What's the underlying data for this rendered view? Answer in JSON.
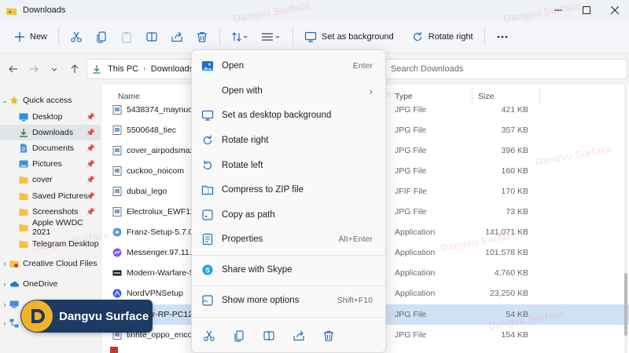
{
  "window": {
    "title": "Downloads"
  },
  "toolbar": {
    "new_label": "New",
    "set_background_label": "Set as background",
    "rotate_right_label": "Rotate right"
  },
  "address": {
    "crumbs": [
      "This PC",
      "Downloads"
    ],
    "search_placeholder": "Search Downloads"
  },
  "sidebar": {
    "items": [
      {
        "label": "Quick access",
        "pinned": false
      },
      {
        "label": "Desktop",
        "pinned": true
      },
      {
        "label": "Downloads",
        "pinned": true
      },
      {
        "label": "Documents",
        "pinned": true
      },
      {
        "label": "Pictures",
        "pinned": true
      },
      {
        "label": "cover",
        "pinned": true
      },
      {
        "label": "Saved Pictures",
        "pinned": true
      },
      {
        "label": "Screenshots",
        "pinned": true
      },
      {
        "label": "Apple WWDC 2021",
        "pinned": false
      },
      {
        "label": "Telegram Desktop",
        "pinned": false
      },
      {
        "label": "Creative Cloud Files",
        "pinned": false
      },
      {
        "label": "OneDrive",
        "pinned": false
      }
    ]
  },
  "columns": {
    "name": "Name",
    "type": "Type",
    "size": "Size"
  },
  "files": [
    {
      "name": "5438374_maynuongbanh",
      "type": "JPG File",
      "size": "421 KB"
    },
    {
      "name": "5500648_tiec",
      "type": "JPG File",
      "size": "357 KB"
    },
    {
      "name": "cover_airpodsmax_fix",
      "type": "JPG File",
      "size": "396 KB"
    },
    {
      "name": "cuckoo_noicom",
      "type": "JPG File",
      "size": "160 KB"
    },
    {
      "name": "dubai_lego",
      "type": "JFIF File",
      "size": "170 KB"
    },
    {
      "name": "Electrolux_EWF1141S",
      "type": "JPG File",
      "size": "73 KB"
    },
    {
      "name": "Franz-Setup-5.7.0",
      "type": "Application",
      "size": "141,071 KB"
    },
    {
      "name": "Messenger.97.11.116",
      "type": "Application",
      "size": "101,578 KB"
    },
    {
      "name": "Modern-Warfare-Setup",
      "type": "Application",
      "size": "4,760 KB"
    },
    {
      "name": "NordVPNSetup",
      "type": "Application",
      "size": "23,250 KB"
    },
    {
      "name": "Pioneer-RP-PC128",
      "type": "JPG File",
      "size": "54 KB"
    },
    {
      "name": "tinhte_oppo_encox",
      "type": "JPG File",
      "size": "154 KB"
    }
  ],
  "context_menu": {
    "items": [
      {
        "label": "Open",
        "shortcut": "Enter",
        "icon": "photo-icon"
      },
      {
        "label": "Open with",
        "shortcut": "",
        "icon": "blank"
      },
      {
        "label": "Set as desktop background",
        "shortcut": "",
        "icon": "desktop-icon"
      },
      {
        "label": "Rotate right",
        "shortcut": "",
        "icon": "rotate-right-icon"
      },
      {
        "label": "Rotate left",
        "shortcut": "",
        "icon": "rotate-left-icon"
      },
      {
        "label": "Compress to ZIP file",
        "shortcut": "",
        "icon": "zip-icon"
      },
      {
        "label": "Copy as path",
        "shortcut": "",
        "icon": "path-icon"
      },
      {
        "label": "Properties",
        "shortcut": "Alt+Enter",
        "icon": "properties-icon"
      },
      {
        "label": "Share with Skype",
        "shortcut": "",
        "icon": "skype-icon"
      },
      {
        "label": "Show more options",
        "shortcut": "Shift+F10",
        "icon": "more-options-icon"
      }
    ]
  },
  "watermark": {
    "brand": "Dangvu Surface"
  },
  "colors": {
    "accent": "#0067c0",
    "folder": "#f3c443",
    "selected_row": "#cfe2f5",
    "badge_bg": "#1d3a63"
  }
}
